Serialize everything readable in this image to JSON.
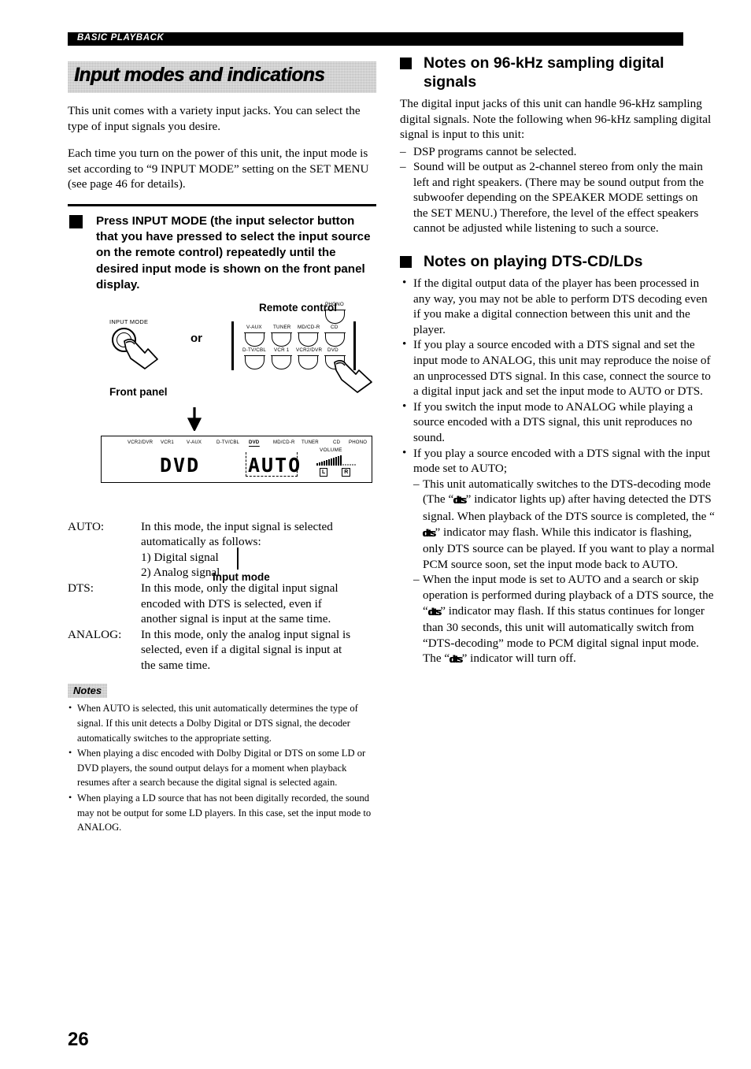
{
  "running_header": {
    "label": "BASIC PLAYBACK"
  },
  "page_number": "26",
  "left_column": {
    "section_title": "Input modes and indications",
    "intro_paragraph_1": "This unit comes with a variety input jacks. You can select the type of input signals you desire.",
    "intro_paragraph_2": "Each time you turn on the power of this unit, the input mode is set according to “9 INPUT MODE” setting on the SET MENU (see page 46 for details).",
    "instruction": "Press INPUT MODE (the input selector button that you have pressed to select the input source on the remote control) repeatedly until the desired input mode is shown on the front panel display.",
    "diagram": {
      "knob_label": "INPUT MODE",
      "or_label": "or",
      "front_panel_caption": "Front panel",
      "remote_caption": "Remote control",
      "remote_buttons": [
        {
          "label": "PHONO",
          "row": "top"
        },
        {
          "label": "V-AUX",
          "row": "middle"
        },
        {
          "label": "TUNER",
          "row": "middle"
        },
        {
          "label": "MD/CD-R",
          "row": "middle"
        },
        {
          "label": "CD",
          "row": "middle"
        },
        {
          "label": "D-TV/CBL",
          "row": "bottom"
        },
        {
          "label": "VCR 1",
          "row": "bottom"
        },
        {
          "label": "VCR2/DVR",
          "row": "bottom"
        },
        {
          "label": "DVD",
          "row": "bottom"
        }
      ]
    },
    "fl_display": {
      "source_labels": [
        "VCR2/DVR",
        "VCR1",
        "V-AUX",
        "D-TV/CBL",
        "DVD",
        "MD/CD-R",
        "TUNER",
        "CD",
        "PHONO"
      ],
      "active_source_label": "DVD",
      "main_source_text": "DVD",
      "main_mode_text": "AUTO",
      "volume_label": "VOLUME",
      "channel_left": "L",
      "channel_right": "R",
      "callout": "Input mode"
    },
    "definitions": [
      {
        "term": "AUTO:",
        "lines": [
          "In this mode, the input signal is selected",
          "automatically as follows:",
          "1) Digital signal",
          "2) Analog signal"
        ]
      },
      {
        "term": "DTS:",
        "lines": [
          "In this mode, only the digital input signal",
          "encoded with DTS is selected, even if",
          "another signal is input at the same time."
        ]
      },
      {
        "term": "ANALOG:",
        "lines": [
          "In this mode, only the analog input signal is",
          "selected, even if a digital signal is input at",
          "the same time."
        ]
      }
    ],
    "notes_label": "Notes",
    "notes": [
      "When AUTO is selected, this unit automatically determines the type of signal. If this unit detects a Dolby Digital or DTS signal, the decoder automatically switches to the appropriate setting.",
      "When playing a disc encoded with Dolby Digital or DTS on some LD or DVD players, the sound output delays for a moment when playback resumes after a search because the digital signal is selected again.",
      "When playing a LD source that has not been digitally recorded, the sound may not be output for some LD players. In this case, set the input mode to ANALOG."
    ]
  },
  "right_column": {
    "section_96khz": {
      "heading": "Notes on 96-kHz sampling digital signals",
      "paragraph": "The digital input jacks of this unit can handle 96-kHz sampling digital signals. Note the following when 96-kHz sampling digital signal is input to this unit:",
      "items": [
        "DSP programs cannot be selected.",
        "Sound will be output as 2-channel stereo from only the main left and right speakers. (There may be sound output from the subwoofer depending on the SPEAKER MODE settings on the SET MENU.) Therefore, the level of the effect speakers cannot be adjusted while listening to such a source."
      ]
    },
    "section_dts": {
      "heading": "Notes on playing DTS-CD/LDs",
      "bullets": [
        {
          "text": "If the digital output data of the player has been processed in any way, you may not be able to perform DTS decoding even if you make a digital connection between this unit and the player."
        },
        {
          "text": "If you play a source encoded with a DTS signal and set the input mode to ANALOG, this unit may reproduce the noise of an unprocessed DTS signal. In this case, connect the source to a digital input jack and set the input mode to AUTO or DTS."
        },
        {
          "text": "If you switch the input mode to ANALOG while playing a source encoded with a DTS signal, this unit reproduces no sound."
        },
        {
          "text": "If you play a source encoded with a DTS signal with the input mode set to AUTO;",
          "sub": [
            {
              "prefix": "This unit automatically switches to the DTS-decoding mode (The “",
              "logo": "dts",
              "mid": "” indicator lights up) after having detected the DTS signal. When playback of the DTS source is completed, the “",
              "logo2": "dts",
              "suffix": "” indicator may flash. While this indicator is flashing, only DTS source can be played. If you want to play a normal PCM source soon, set the input mode back to AUTO."
            },
            {
              "prefix": "When the input mode is set to AUTO and a search or skip operation is performed during playback of a DTS source, the “",
              "logo": "dts",
              "mid": "” indicator may flash. If this status continues for longer than 30 seconds, this unit will automatically switch from “DTS-decoding” mode to PCM digital signal input mode. The “",
              "logo2": "dts",
              "suffix": "” indicator will turn off."
            }
          ]
        }
      ]
    }
  },
  "colors": {
    "ink": "#000000",
    "banner_gray": "#b9b9b9",
    "paper": "#ffffff"
  }
}
